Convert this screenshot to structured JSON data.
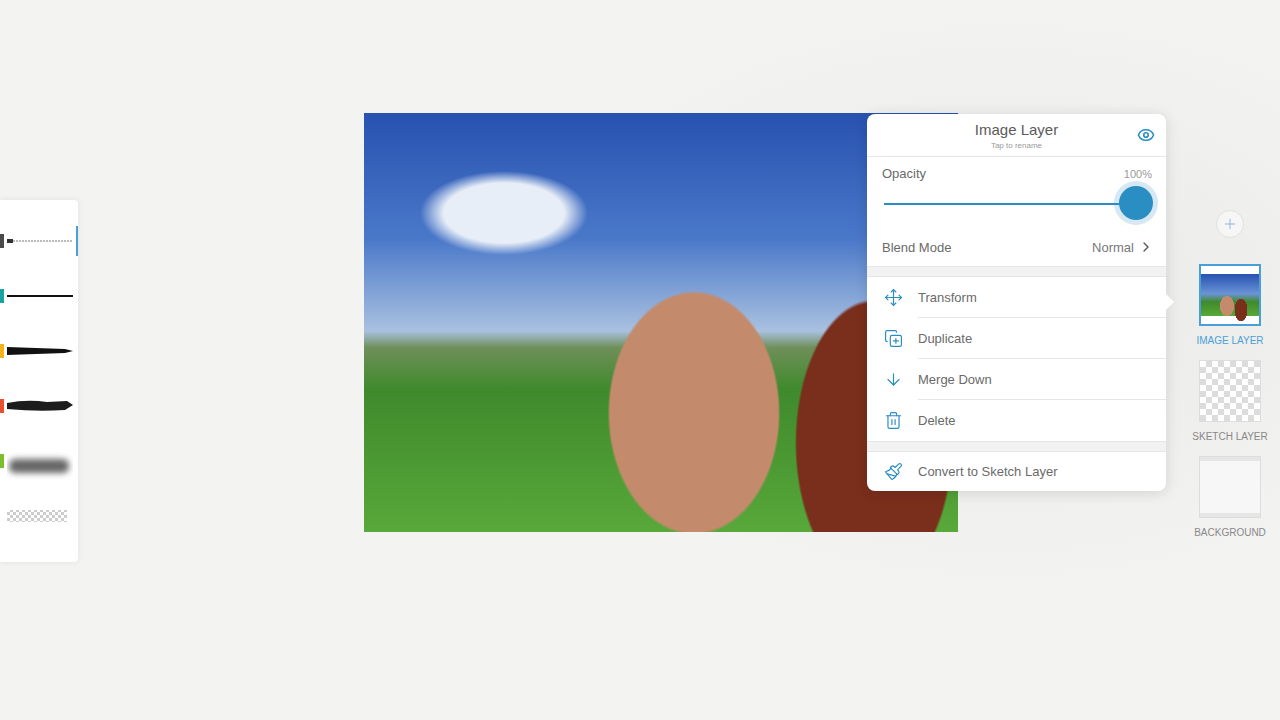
{
  "layer_panel": {
    "title": "Image Layer",
    "subtitle": "Tap to rename",
    "visible": true,
    "opacity": {
      "label": "Opacity",
      "reading": "100%",
      "level": 1.0
    },
    "blend_mode": {
      "label": "Blend Mode",
      "value": "Normal"
    },
    "actions": [
      {
        "label": "Transform"
      },
      {
        "label": "Duplicate"
      },
      {
        "label": "Merge Down"
      },
      {
        "label": "Delete"
      },
      {
        "label": "Convert to Sketch Layer"
      }
    ]
  },
  "layers": [
    {
      "name": "IMAGE LAYER",
      "kind": "image",
      "selected": true
    },
    {
      "name": "SKETCH LAYER",
      "kind": "sketch",
      "selected": false
    },
    {
      "name": "BACKGROUND",
      "kind": "background",
      "selected": false
    }
  ],
  "brushes": [
    {
      "kind": "pencil",
      "color": "#4a4a4a",
      "selected": true
    },
    {
      "kind": "pen",
      "color": "#1aa3a3",
      "selected": false
    },
    {
      "kind": "marker",
      "color": "#f2b41c",
      "selected": false
    },
    {
      "kind": "paint",
      "color": "#e8502f",
      "selected": false
    },
    {
      "kind": "blend",
      "color": "#7bbf2a",
      "selected": false
    },
    {
      "kind": "eraser",
      "color": "#ffffff",
      "selected": false
    }
  ]
}
